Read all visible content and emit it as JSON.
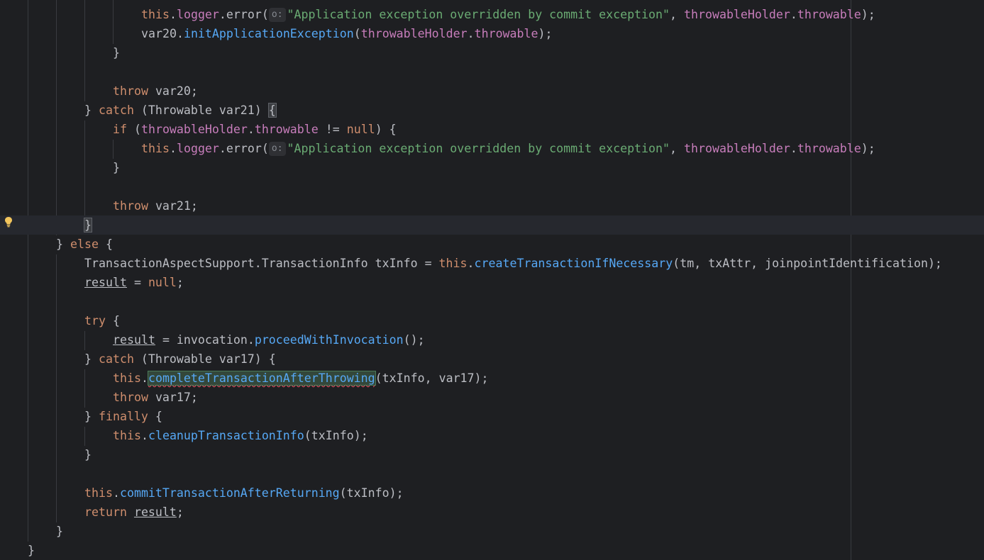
{
  "editor": {
    "colors": {
      "background": "#1e1f22",
      "keyword": "#cf8e6d",
      "method": "#56a8f5",
      "string": "#6aab73",
      "text": "#bcbec4",
      "usage_highlight": "#33473a",
      "error_underline": "#f75464",
      "intention_bulb": "#f2c55c"
    },
    "gutter_icon": "lightbulb-icon",
    "param_hint": "o:",
    "lines": {
      "l1": {
        "this": "this",
        "logger": "logger",
        "error": "error",
        "open": "(",
        "msg": "\"Application exception overridden by commit exception\"",
        "comma": ", ",
        "holder": "throwableHolder",
        "throwable": "throwable",
        "end": ");"
      },
      "l2": {
        "var": "var20",
        "method": "initApplicationException",
        "open": "(",
        "holder": "throwableHolder",
        "throwable": "throwable",
        "end": ");"
      },
      "l3": "}",
      "l5": {
        "kw": "throw",
        "var": " var20;"
      },
      "l6": {
        "close": "} ",
        "kw": "catch",
        "open": " (",
        "type": "Throwable",
        "var": " var21) ",
        "brace": "{"
      },
      "l7": {
        "kw": "if",
        "open": " (",
        "holder": "throwableHolder",
        "throwable": "throwable",
        "op": " != ",
        "null": "null",
        "end": ") {"
      },
      "l8": {
        "this": "this",
        "logger": "logger",
        "error": "error",
        "open": "(",
        "msg": "\"Application exception overridden by commit exception\"",
        "comma": ", ",
        "holder": "throwableHolder",
        "throwable": "throwable",
        "end": ");"
      },
      "l9": "}",
      "l11": {
        "kw": "throw",
        "var": " var21;"
      },
      "l12": "}",
      "l13": {
        "close": "} ",
        "kw": "else",
        "end": " {"
      },
      "l14": {
        "outer": "TransactionAspectSupport",
        "inner": "TransactionInfo",
        "var": " txInfo = ",
        "this": "this",
        "method": "createTransactionIfNecessary",
        "open": "(",
        "a1": "tm",
        "a2": "txAttr",
        "a3": "joinpointIdentification",
        "end": ");"
      },
      "l15": {
        "var": "result",
        "op": " = ",
        "null": "null",
        "end": ";"
      },
      "l17": {
        "kw": "try",
        "end": " {"
      },
      "l18": {
        "var": "result",
        "op": " = invocation.",
        "method": "proceedWithInvocation",
        "end": "();"
      },
      "l19": {
        "close": "} ",
        "kw": "catch",
        "open": " (",
        "type": "Throwable",
        "var": " var17) {"
      },
      "l20": {
        "this": "this",
        "method": "completeTransactionAfterThrowing",
        "args": "(txInfo, var17);"
      },
      "l21": {
        "kw": "throw",
        "var": " var17;"
      },
      "l22": {
        "close": "} ",
        "kw": "finally",
        "end": " {"
      },
      "l23": {
        "this": "this",
        "method": "cleanupTransactionInfo",
        "args": "(txInfo);"
      },
      "l24": "}",
      "l26": {
        "this": "this",
        "method": "commitTransactionAfterReturning",
        "args": "(txInfo);"
      },
      "l27": {
        "kw": "return",
        "var": "result",
        "end": ";"
      },
      "l28": "}",
      "l29": "}"
    }
  }
}
